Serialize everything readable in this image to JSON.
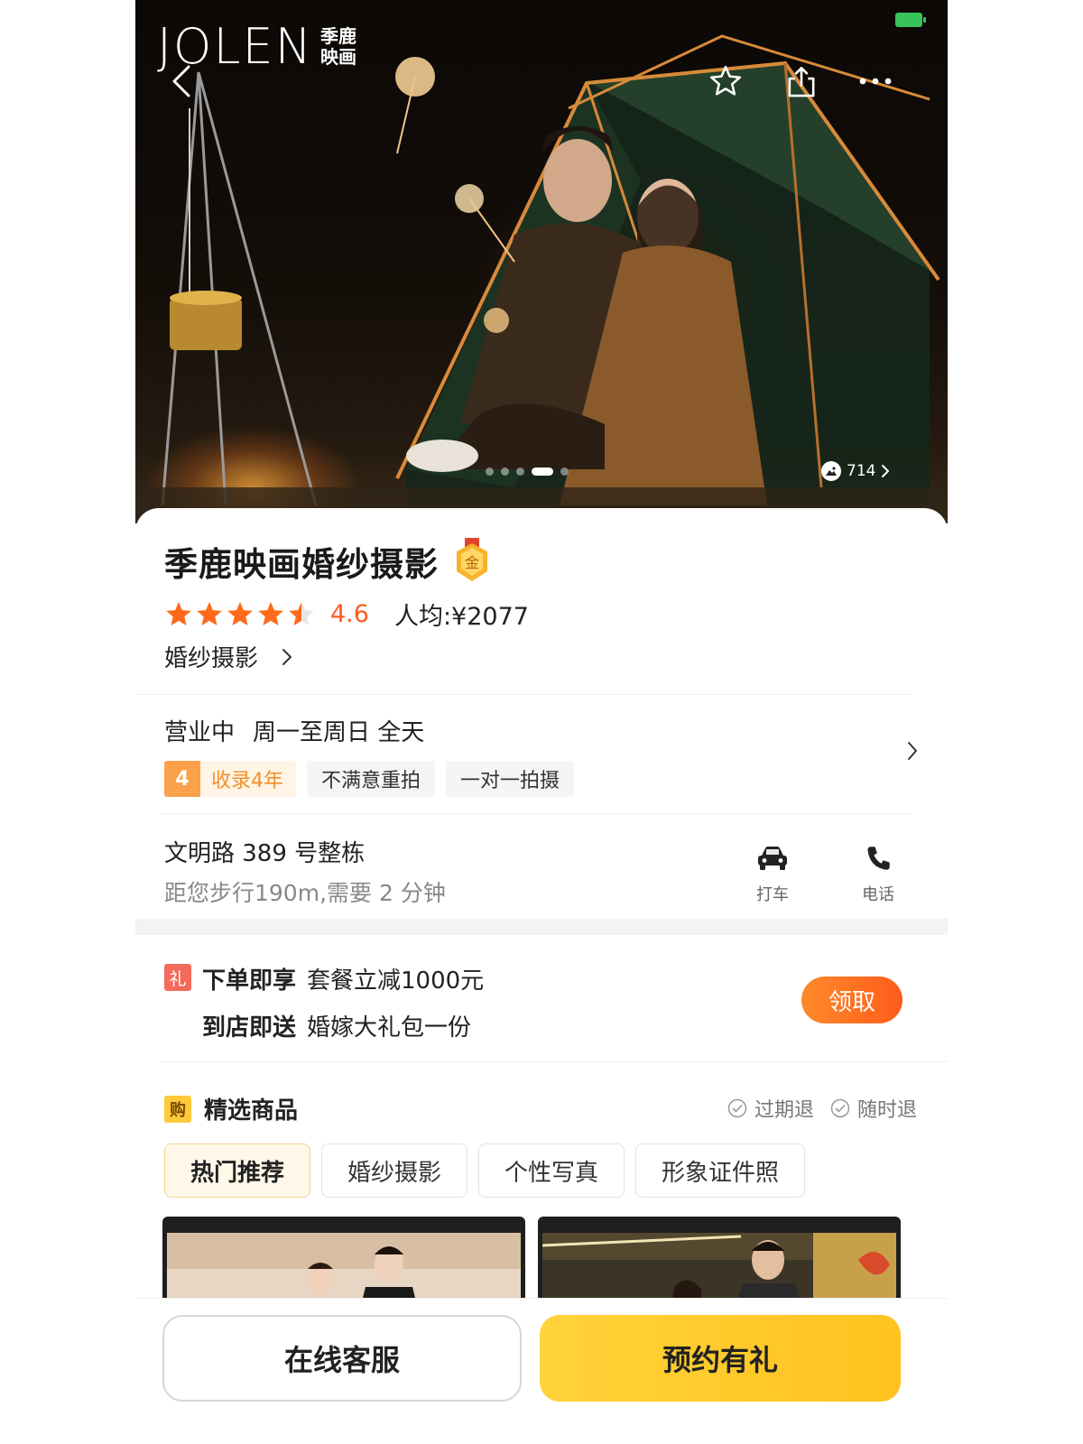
{
  "hero": {
    "brand_word": "JOLEN",
    "brand_cn": "季鹿映画",
    "photo_count": "714",
    "carousel_dots": 5,
    "carousel_active_index": 3
  },
  "shop": {
    "title": "季鹿映画婚纱摄影",
    "badge_label": "金",
    "rating": "4.6",
    "rating_stars": 4.5,
    "avg_price": "人均:¥2077",
    "category": "婚纱摄影"
  },
  "hours": {
    "status": "营业中",
    "schedule": "周一至周日 全天"
  },
  "tags": {
    "years_num": "4",
    "years_label": "收录4年",
    "tag2": "不满意重拍",
    "tag3": "一对一拍摄"
  },
  "address": {
    "line": "文明路 389 号整栋",
    "distance": "距您步行190m,需要 2 分钟",
    "taxi_label": "打车",
    "phone_label": "电话"
  },
  "promo": {
    "badge": "礼",
    "line1_lead": "下单即享",
    "line1_text": "套餐立减1000元",
    "line2_lead": "到店即送",
    "line2_text": "婚嫁大礼包一份",
    "claim_label": "领取"
  },
  "goods": {
    "badge": "购",
    "title": "精选商品",
    "guarantee1": "过期退",
    "guarantee2": "随时退",
    "tabs": [
      "热门推荐",
      "婚纱摄影",
      "个性写真",
      "形象证件照"
    ]
  },
  "bottom": {
    "service_label": "在线客服",
    "book_label": "预约有礼"
  },
  "colors": {
    "accent_orange": "#ff5a1f",
    "brand_yellow": "#ffc93a",
    "star": "#ff6a1a"
  }
}
